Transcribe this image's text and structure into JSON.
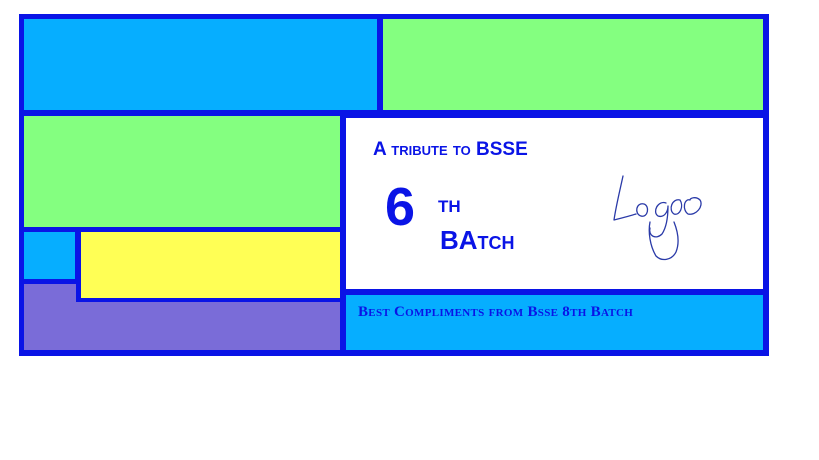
{
  "banner": {
    "tribute_text": "A tribute to BSSE",
    "batch_number": "6",
    "batch_suffix": "th",
    "batch_word": "BAtch",
    "compliments_text": "Best Compliments from Bsse 8th Batch",
    "logo_text": "Logo"
  },
  "colors": {
    "border": "#0a14e6",
    "cyan": "#06aeff",
    "green": "#84ff80",
    "yellow": "#ffff55",
    "purple": "#7a6cd8",
    "white": "#ffffff",
    "text": "#0a14e6",
    "logo_ink": "#2a3aa8"
  }
}
